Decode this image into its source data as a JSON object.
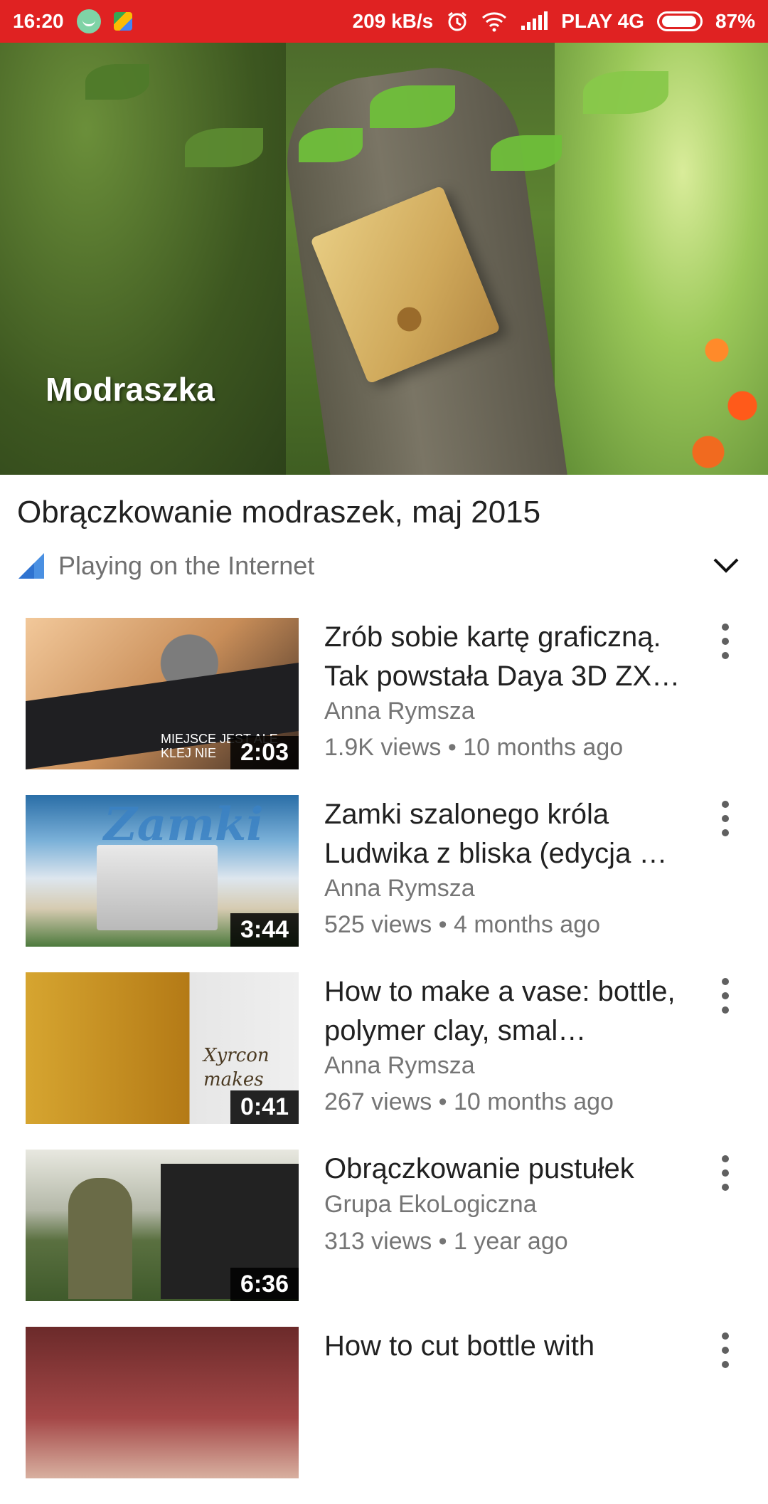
{
  "status_bar": {
    "time": "16:20",
    "speed": "209 kB/s",
    "carrier": "PLAY 4G",
    "battery": "87%"
  },
  "player": {
    "overlay_text": "Modraszka"
  },
  "video": {
    "title": "Obrączkowanie modraszek, maj 2015",
    "subtitle": "Playing on the Internet"
  },
  "list": [
    {
      "title": "Zrób sobie kartę graficzną. Tak powstała Daya 3D ZX…",
      "channel": "Anna Rymsza",
      "meta": "1.9K views • 10 months ago",
      "duration": "2:03",
      "thumb_text": "MIEJSCE JEST ALE KLEJ NIE"
    },
    {
      "title": "Zamki szalonego króla Ludwika z bliska (edycja …",
      "channel": "Anna Rymsza",
      "meta": "525 views • 4 months ago",
      "duration": "3:44",
      "thumb_text": "Zamki"
    },
    {
      "title": "How to make a vase: bottle, polymer clay, smal…",
      "channel": "Anna Rymsza",
      "meta": "267 views • 10 months ago",
      "duration": "0:41",
      "thumb_text": "Xyrcon makes"
    },
    {
      "title": "Obrączkowanie pustułek",
      "channel": "Grupa EkoLogiczna",
      "meta": "313 views • 1 year ago",
      "duration": "6:36",
      "thumb_text": ""
    },
    {
      "title": "How to cut bottle with",
      "channel": "",
      "meta": "",
      "duration": "",
      "thumb_text": ""
    }
  ]
}
